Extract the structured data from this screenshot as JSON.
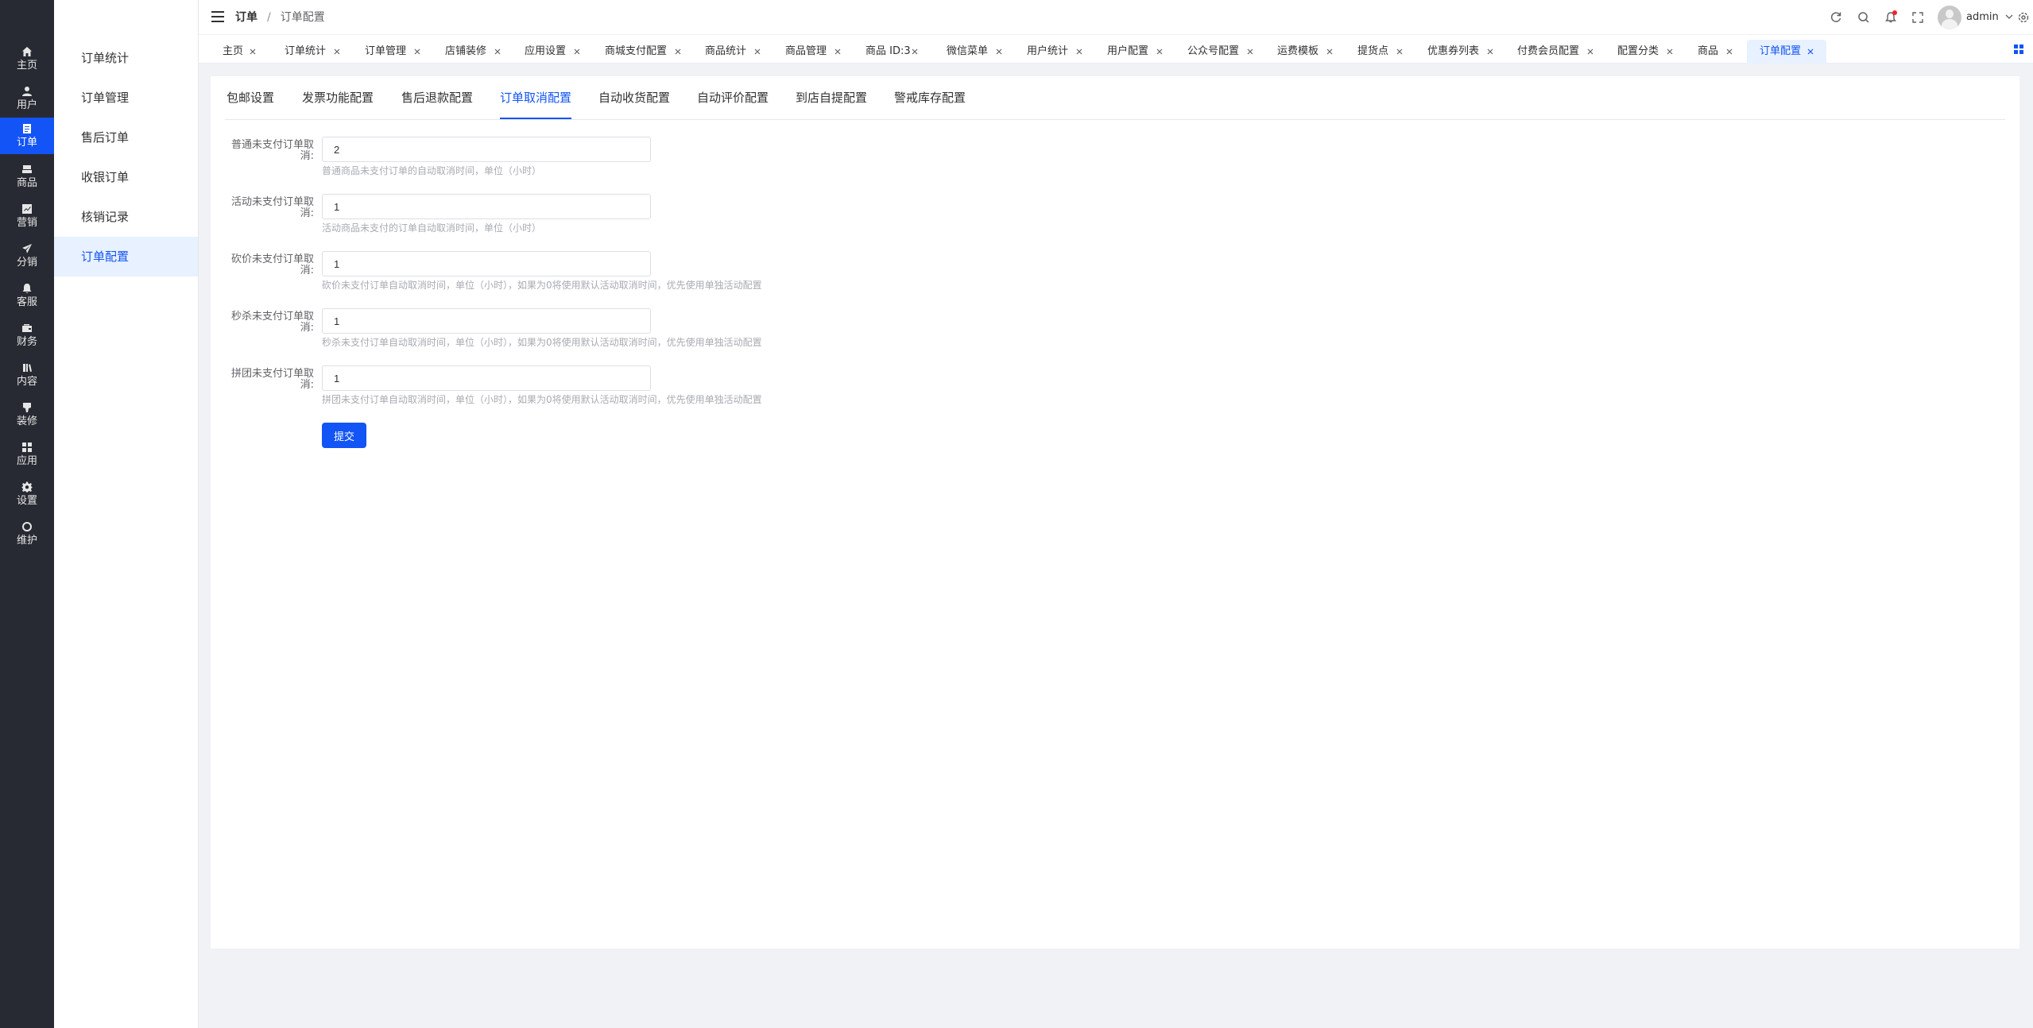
{
  "iconbar": {
    "items": [
      {
        "label": "主页",
        "icon": "home-icon"
      },
      {
        "label": "用户",
        "icon": "user-icon"
      },
      {
        "label": "订单",
        "icon": "order-icon"
      },
      {
        "label": "商品",
        "icon": "goods-icon"
      },
      {
        "label": "营销",
        "icon": "marketing-icon"
      },
      {
        "label": "分销",
        "icon": "paper-plane-icon"
      },
      {
        "label": "客服",
        "icon": "bell-icon"
      },
      {
        "label": "财务",
        "icon": "wallet-icon"
      },
      {
        "label": "内容",
        "icon": "book-icon"
      },
      {
        "label": "装修",
        "icon": "brush-icon"
      },
      {
        "label": "应用",
        "icon": "apps-icon"
      },
      {
        "label": "设置",
        "icon": "gear-icon"
      },
      {
        "label": "维护",
        "icon": "maintenance-icon"
      }
    ],
    "active_color": "#1254f5"
  },
  "submenu": {
    "items": [
      {
        "label": "订单统计"
      },
      {
        "label": "订单管理"
      },
      {
        "label": "售后订单"
      },
      {
        "label": "收银订单"
      },
      {
        "label": "核销记录"
      },
      {
        "label": "订单配置"
      }
    ]
  },
  "header": {
    "breadcrumb": {
      "first": "订单",
      "separator": "/",
      "current": "订单配置"
    },
    "username": "admin",
    "icons": [
      "refresh-icon",
      "search-icon",
      "notification-bell-icon",
      "fullscreen-icon",
      "settings-icon"
    ]
  },
  "tabs": [
    {
      "label": "主页"
    },
    {
      "label": "订单统计"
    },
    {
      "label": "订单管理"
    },
    {
      "label": "店铺装修"
    },
    {
      "label": "应用设置"
    },
    {
      "label": "商城支付配置"
    },
    {
      "label": "商品统计"
    },
    {
      "label": "商品管理"
    },
    {
      "label": "商品 ID:3"
    },
    {
      "label": "微信菜单"
    },
    {
      "label": "用户统计"
    },
    {
      "label": "用户配置"
    },
    {
      "label": "公众号配置"
    },
    {
      "label": "运费模板"
    },
    {
      "label": "提货点"
    },
    {
      "label": "优惠券列表"
    },
    {
      "label": "付费会员配置"
    },
    {
      "label": "配置分类"
    },
    {
      "label": "商品"
    },
    {
      "label": "订单配置"
    }
  ],
  "config_tabs": [
    {
      "label": "包邮设置"
    },
    {
      "label": "发票功能配置"
    },
    {
      "label": "售后退款配置"
    },
    {
      "label": "订单取消配置"
    },
    {
      "label": "自动收货配置"
    },
    {
      "label": "自动评价配置"
    },
    {
      "label": "到店自提配置"
    },
    {
      "label": "警戒库存配置"
    }
  ],
  "form": {
    "fields": [
      {
        "label": "普通未支付订单取消:",
        "value": "2",
        "hint": "普通商品未支付订单的自动取消时间，单位（小时）"
      },
      {
        "label": "活动未支付订单取消:",
        "value": "1",
        "hint": "活动商品未支付的订单自动取消时间，单位（小时）"
      },
      {
        "label": "砍价未支付订单取消:",
        "value": "1",
        "hint": "砍价未支付订单自动取消时间，单位（小时），如果为0将使用默认活动取消时间，优先使用单独活动配置"
      },
      {
        "label": "秒杀未支付订单取消:",
        "value": "1",
        "hint": "秒杀未支付订单自动取消时间，单位（小时），如果为0将使用默认活动取消时间，优先使用单独活动配置"
      },
      {
        "label": "拼团未支付订单取消:",
        "value": "1",
        "hint": "拼团未支付订单自动取消时间，单位（小时），如果为0将使用默认活动取消时间，优先使用单独活动配置"
      }
    ],
    "submit_label": "提交"
  }
}
